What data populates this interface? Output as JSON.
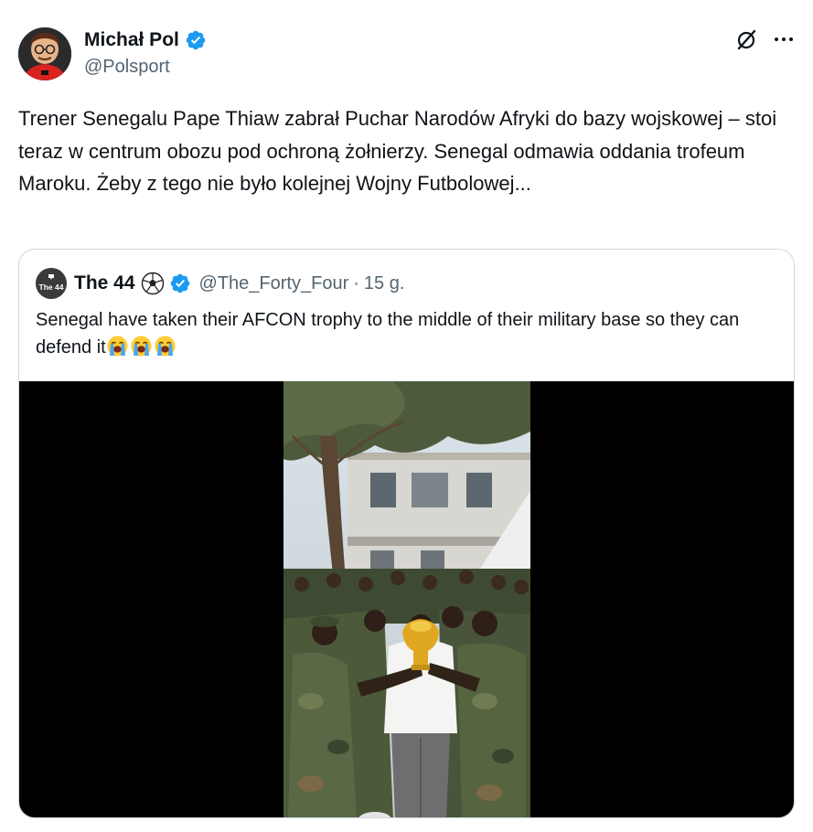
{
  "tweet": {
    "author_name": "Michał Pol",
    "author_handle": "@Polsport",
    "text": "Trener Senegalu Pape Thiaw zabrał Puchar Narodów Afryki do bazy wojskowej – stoi teraz w centrum obozu pod ochroną żołnierzy. Senegal odmawia oddania trofeum Maroku. Żeby z tego nie było kolejnej Wojny Futbolowej..."
  },
  "quote": {
    "author_name": "The 44",
    "avatar_label": "The 44",
    "author_handle": "@The_Forty_Four",
    "separator": "·",
    "time": "15 g.",
    "text": "Senegal have taken their AFCON trophy to the middle of their military base so they can defend it"
  },
  "icons": {
    "verified": "verified-badge-icon",
    "grok": "grok-icon",
    "more": "more-options-icon",
    "soccer_ball": "soccer-ball-icon",
    "emoji": "loudly-crying-face-icon"
  },
  "colors": {
    "verified_blue": "#1d9bf0",
    "secondary_text": "#536471",
    "primary_text": "#0f1419",
    "border": "#cfd9de",
    "media_background": "#000000"
  }
}
